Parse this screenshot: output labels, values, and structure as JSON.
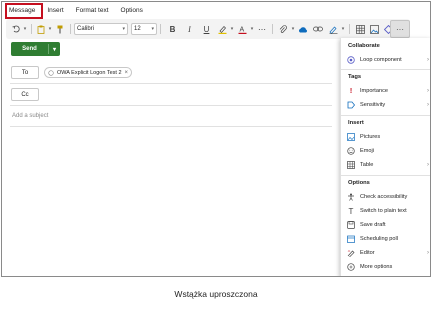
{
  "tabs": [
    "Message",
    "Insert",
    "Format text",
    "Options"
  ],
  "toolbar": {
    "font_name": "Calibri",
    "font_size": "12",
    "bold": "B",
    "italic": "I",
    "underline": "U",
    "more": "···"
  },
  "compose": {
    "send_label": "Send",
    "to_label": "To",
    "cc_label": "Cc",
    "recipient": "OWA Explicit Logon Test 2",
    "subject_placeholder": "Add a subject"
  },
  "panel": {
    "collaborate": {
      "title": "Collaborate",
      "items": [
        {
          "label": "Loop component",
          "icon": "loop-icon"
        }
      ]
    },
    "tags": {
      "title": "Tags",
      "items": [
        {
          "label": "Importance",
          "icon": "exclamation-icon"
        },
        {
          "label": "Sensitivity",
          "icon": "sensitivity-icon"
        }
      ]
    },
    "insert": {
      "title": "Insert",
      "items": [
        {
          "label": "Pictures",
          "icon": "picture-icon"
        },
        {
          "label": "Emoji",
          "icon": "emoji-icon"
        },
        {
          "label": "Table",
          "icon": "table-icon"
        }
      ]
    },
    "options": {
      "title": "Options",
      "items": [
        {
          "label": "Check accessibility",
          "icon": "accessibility-icon"
        },
        {
          "label": "Switch to plain text",
          "icon": "text-icon"
        },
        {
          "label": "Save draft",
          "icon": "save-icon"
        },
        {
          "label": "Scheduling poll",
          "icon": "poll-icon"
        },
        {
          "label": "Editor",
          "icon": "editor-icon"
        },
        {
          "label": "More options",
          "icon": "more-icon"
        }
      ]
    }
  },
  "caption": "Wstążka uproszczona",
  "colors": {
    "send": "#2f7d32",
    "highlight": "#c50f1f",
    "accent": "#0f6cbd"
  }
}
